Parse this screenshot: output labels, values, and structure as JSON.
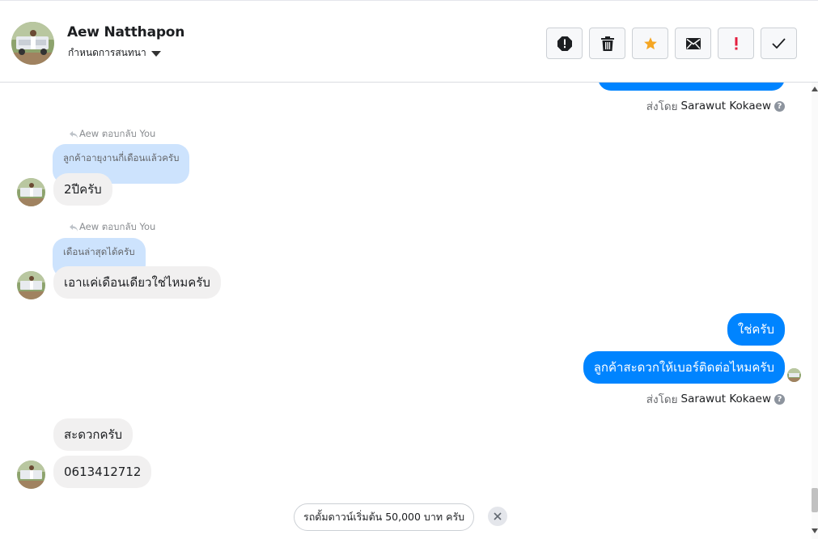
{
  "header": {
    "name": "Aew Natthapon",
    "subtitle": "กำหนดการสนทนา",
    "actions": [
      {
        "icon": "report-icon",
        "color": "#1c1e21"
      },
      {
        "icon": "trash-icon",
        "color": "#1c1e21"
      },
      {
        "icon": "star-icon",
        "color": "#f5a623"
      },
      {
        "icon": "envelope-icon",
        "color": "#1c1e21"
      },
      {
        "icon": "exclamation-icon",
        "color": "#e41e3f"
      },
      {
        "icon": "checkmark-icon",
        "color": "#1c1e21"
      }
    ]
  },
  "messages": {
    "sent_by_1": {
      "prefix": "ส่งโดย",
      "name": "Sarawut Kokaew"
    },
    "reply_1": {
      "label": "Aew ตอบกลับ You",
      "quote": "ลูกค้าอายุงานกี่เดือนแล้วครับ",
      "text": "2ปีครับ"
    },
    "reply_2": {
      "label": "Aew ตอบกลับ You",
      "quote": "เดือนล่าสุดได้ครับ",
      "text": "เอาแค่เดือนเดียวใช่ไหมครับ"
    },
    "out_1": "ใช่ครับ",
    "out_2": "ลูกค้าสะดวกให้เบอร์ติดต่อไหมครับ",
    "sent_by_2": {
      "prefix": "ส่งโดย",
      "name": "Sarawut Kokaew"
    },
    "in_1": "สะดวกครับ",
    "in_2": "0613412712"
  },
  "suggestion": {
    "text": "รถดั้มดาวน์เริ่มต้น 50,000 บาท ครับ"
  },
  "colors": {
    "accent": "#0084ff",
    "incoming": "#f1f0f0",
    "quote": "#cde3fd"
  }
}
